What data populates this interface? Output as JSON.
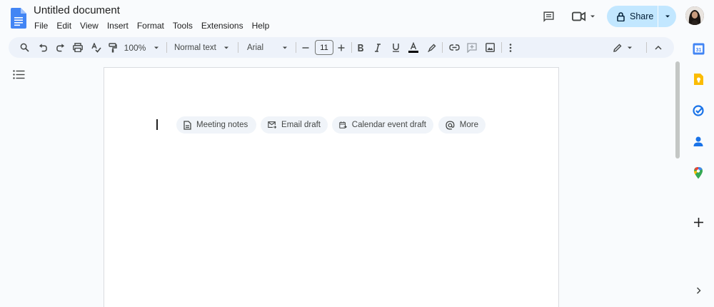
{
  "header": {
    "doc_title": "Untitled document",
    "menu": [
      "File",
      "Edit",
      "View",
      "Insert",
      "Format",
      "Tools",
      "Extensions",
      "Help"
    ],
    "share_label": "Share"
  },
  "toolbar": {
    "zoom": "100%",
    "style": "Normal text",
    "font": "Arial",
    "font_size": "11",
    "underline_color": "#000000"
  },
  "chips": [
    {
      "label": "Meeting notes",
      "icon": "document-icon"
    },
    {
      "label": "Email draft",
      "icon": "email-icon"
    },
    {
      "label": "Calendar event draft",
      "icon": "calendar-icon"
    },
    {
      "label": "More",
      "icon": "at-sign-icon"
    }
  ],
  "side_panel": [
    "calendar-app-icon",
    "keep-app-icon",
    "tasks-app-icon",
    "contacts-app-icon",
    "maps-app-icon",
    "add-icon",
    "expand-icon"
  ],
  "colors": {
    "accent": "#c2e7ff",
    "docs_blue": "#4285f4",
    "toolbar_bg": "#edf2fa",
    "page_bg": "#f9fbfd"
  }
}
